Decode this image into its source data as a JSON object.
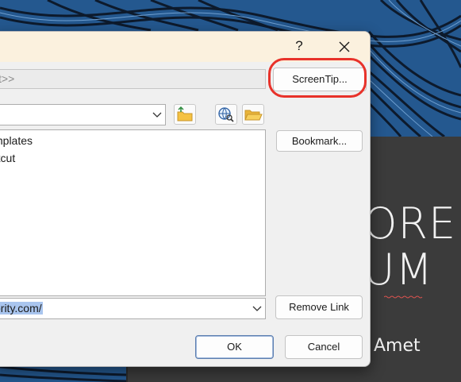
{
  "dialog": {
    "help_label": "?",
    "display_text_value": "t>>",
    "screentip_label": "ScreenTip...",
    "bookmark_label": "Bookmark...",
    "remove_link_label": "Remove Link",
    "ok_label": "OK",
    "cancel_label": "Cancel",
    "address_value": "ority.com/",
    "list_items": [
      {
        "label": "mplates"
      },
      {
        "label": "rtcut"
      }
    ],
    "icons": {
      "close": "close-icon",
      "up_folder": "folder-up-icon",
      "browse_web": "globe-search-icon",
      "browse_file": "open-folder-icon",
      "dropdown": "chevron-down-icon"
    }
  },
  "slide": {
    "title_text": "OREM\nUM",
    "subtitle_text": "Amet"
  },
  "colors": {
    "background_pattern": "#1f4f86",
    "slide_background": "#3b3b3b",
    "titlebar": "#fbf1de",
    "annotation_ring": "#e8322a",
    "selection": "#a9c5ee"
  }
}
